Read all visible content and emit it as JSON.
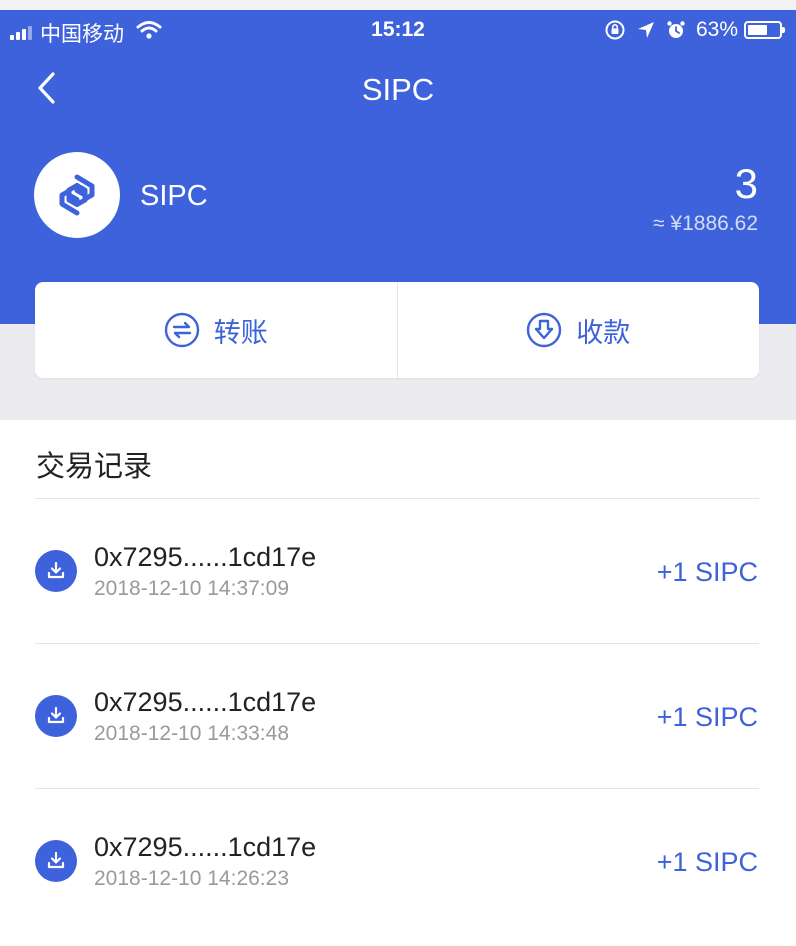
{
  "status_bar": {
    "carrier": "中国移动",
    "time": "15:12",
    "battery": "63%",
    "battery_level": 0.63
  },
  "nav": {
    "title": "SIPC"
  },
  "asset": {
    "name": "SIPC",
    "amount": "3",
    "fiat_value": "≈ ¥1886.62"
  },
  "actions": {
    "transfer_label": "转账",
    "receive_label": "收款"
  },
  "transactions": {
    "title": "交易记录",
    "items": [
      {
        "hash": "0x7295......1cd17e",
        "time": "2018-12-10 14:37:09",
        "amount": "+1 SIPC"
      },
      {
        "hash": "0x7295......1cd17e",
        "time": "2018-12-10 14:33:48",
        "amount": "+1 SIPC"
      },
      {
        "hash": "0x7295......1cd17e",
        "time": "2018-12-10 14:26:23",
        "amount": "+1 SIPC"
      }
    ]
  },
  "colors": {
    "primary": "#3d62db",
    "background_gray": "#ececf0",
    "text_dark": "#222222",
    "text_muted": "#9a9a9a"
  },
  "icons": {
    "back": "chevron-left-icon",
    "coin": "sipc-logo",
    "transfer": "transfer-icon",
    "receive": "receive-icon",
    "tx": "download-tray-icon"
  }
}
